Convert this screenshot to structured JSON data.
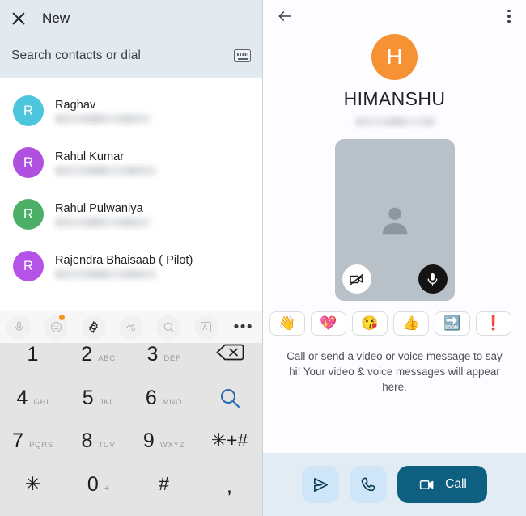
{
  "left": {
    "header": {
      "close_icon": "close-icon",
      "title": "New",
      "search_placeholder": "Search contacts or dial",
      "dialpad_icon": "dialpad-keyboard-icon"
    },
    "contacts": [
      {
        "initial": "R",
        "name": "Raghav",
        "color": "#4bc6dd"
      },
      {
        "initial": "R",
        "name": "Rahul Kumar",
        "color": "#b050e0"
      },
      {
        "initial": "R",
        "name": "Rahul Pulwaniya",
        "color": "#4caf66"
      },
      {
        "initial": "R",
        "name": "Rajendra Bhaisaab ( Pilot)",
        "color": "#b553e8"
      }
    ],
    "keyboard_toolbar": [
      {
        "icon": "microphone-icon",
        "glyph": " ",
        "badge": false
      },
      {
        "icon": "emoji-icon",
        "glyph": " ",
        "badge": true
      },
      {
        "icon": "gear-icon",
        "glyph": " ",
        "badge": false
      },
      {
        "icon": "sticker-icon",
        "glyph": " ",
        "badge": false
      },
      {
        "icon": "search-icon",
        "glyph": " ",
        "badge": false
      },
      {
        "icon": "translate-icon",
        "glyph": " ",
        "badge": false
      },
      {
        "icon": "more-options-icon",
        "glyph": "•••",
        "badge": false
      }
    ],
    "dialpad": [
      {
        "key": "1",
        "sub": "",
        "type": "digit"
      },
      {
        "key": "2",
        "sub": "ABC",
        "type": "digit"
      },
      {
        "key": "3",
        "sub": "DEF",
        "type": "digit"
      },
      {
        "key": "",
        "sub": "",
        "type": "backspace",
        "icon": "backspace-icon"
      },
      {
        "key": "4",
        "sub": "GHI",
        "type": "digit"
      },
      {
        "key": "5",
        "sub": "JKL",
        "type": "digit"
      },
      {
        "key": "6",
        "sub": "MNO",
        "type": "digit"
      },
      {
        "key": "",
        "sub": "",
        "type": "search",
        "icon": "search-icon"
      },
      {
        "key": "7",
        "sub": "PQRS",
        "type": "digit"
      },
      {
        "key": "8",
        "sub": "TUV",
        "type": "digit"
      },
      {
        "key": "9",
        "sub": "WXYZ",
        "type": "digit"
      },
      {
        "key": "✳+#",
        "sub": "",
        "type": "symbol"
      },
      {
        "key": "✳",
        "sub": "",
        "type": "symbol"
      },
      {
        "key": "0",
        "sub": "+",
        "type": "digit"
      },
      {
        "key": "#",
        "sub": "",
        "type": "symbol"
      },
      {
        "key": ",",
        "sub": "",
        "type": "comma"
      }
    ]
  },
  "right": {
    "header": {
      "back_icon": "back-arrow-icon",
      "menu_icon": "more-options-icon"
    },
    "profile": {
      "initial": "H",
      "avatar_color": "#f79234",
      "name": "HIMANSHU"
    },
    "video_preview": {
      "placeholder_icon": "person-placeholder-icon",
      "camera_off_icon": "video-off-icon",
      "mic_icon": "microphone-icon"
    },
    "emoji_chips": [
      {
        "name": "waving-hand-emoji",
        "glyph": "👋"
      },
      {
        "name": "growing-heart-emoji",
        "glyph": "💖"
      },
      {
        "name": "kiss-face-emoji",
        "glyph": "😘"
      },
      {
        "name": "thumbs-up-emoji",
        "glyph": "👍"
      },
      {
        "name": "soon-arrow-emoji",
        "glyph": "🔜"
      },
      {
        "name": "exclamation-emoji",
        "glyph": "❗"
      }
    ],
    "hint": "Call or send a video or voice message to say hi! Your video & voice messages will appear here.",
    "actions": {
      "send_icon": "send-icon",
      "phone_icon": "phone-icon",
      "call_icon": "video-camera-icon",
      "call_label": "Call"
    }
  },
  "colors": {
    "header_bg": "#e2eaef",
    "action_bar_bg": "#e2ecf5",
    "call_button": "#0f6080",
    "accent_blue": "#2b6cb0",
    "dialpad_bg": "#e4e4e4"
  }
}
